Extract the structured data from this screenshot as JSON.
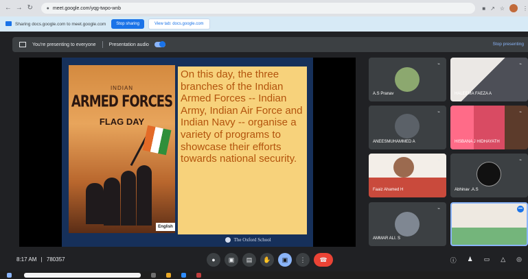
{
  "browser": {
    "url": "meet.google.com/yqg-twpo-wnb",
    "nav_icons": [
      "back-icon",
      "forward-icon",
      "reload-icon",
      "lock-icon"
    ]
  },
  "sharing_bar": {
    "text": "Sharing docs.google.com to meet.google.com",
    "stop_sharing": "Stop sharing",
    "view_tab": "View tab: docs.google.com"
  },
  "presenting_bar": {
    "status": "You're presenting to everyone",
    "audio": "Presentation audio",
    "stop": "Stop presenting"
  },
  "slide": {
    "indian": "INDIAN",
    "armed_forces": "ARMED FORCES",
    "flag_day": "FLAG DAY",
    "english_badge": "English",
    "text": "On this day, the three branches of the Indian Armed Forces -- Indian Army, Indian Air Force and Indian Navy -- organise a variety of programs to showcase their efforts towards national security.",
    "school": "The Oxford School"
  },
  "participants": [
    {
      "name": "A.S Pranav"
    },
    {
      "name": "HALEEMA FAEZA A"
    },
    {
      "name": "ANEESMUHAMMED A"
    },
    {
      "name": "HISBANA J HIDHAYATH"
    },
    {
      "name": "Faaiz Ahamed H"
    },
    {
      "name": "Abhinav .A.S"
    },
    {
      "name": "AMMAR ALI. S"
    },
    {
      "name": ""
    }
  ],
  "meeting": {
    "time": "8:17 AM",
    "separator": "|",
    "code": "780357",
    "controls": [
      "mic-icon",
      "camera-icon",
      "captions-icon",
      "raise-hand-icon",
      "present-icon",
      "more-options-icon",
      "end-call-icon"
    ],
    "right_controls": [
      "info-icon",
      "people-icon",
      "chat-icon",
      "activities-icon",
      "host-controls-icon"
    ]
  },
  "colors": {
    "meet_background": "#202124",
    "tile": "#3c4043",
    "accent": "#8ab4f8",
    "end_call": "#ea4335",
    "slide_text": "#b3540d",
    "slide_panel": "#f7d27b"
  }
}
